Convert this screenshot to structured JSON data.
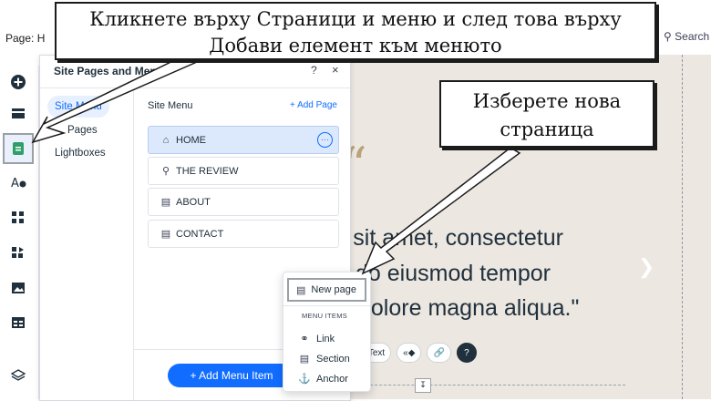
{
  "topbar": {
    "page_label": "Page:",
    "page_name_partial": "H",
    "search_label": "Search"
  },
  "rail": {
    "items": [
      {
        "name": "add-elements"
      },
      {
        "name": "sections"
      },
      {
        "name": "pages-and-menu",
        "active": true
      },
      {
        "name": "site-design"
      },
      {
        "name": "app-market"
      },
      {
        "name": "business-apps"
      },
      {
        "name": "media"
      },
      {
        "name": "cms"
      },
      {
        "name": "layers"
      }
    ]
  },
  "panel": {
    "title": "Site Pages and Menu",
    "help": "?",
    "close": "×",
    "categories": [
      "Site Menu",
      "Pages",
      "Lightboxes"
    ],
    "menu_heading": "Site Menu",
    "add_page": "+ Add Page",
    "menu_items": [
      {
        "label": "HOME",
        "icon": "home-icon"
      },
      {
        "label": "THE REVIEW",
        "icon": "pin-icon"
      },
      {
        "label": "ABOUT",
        "icon": "page-icon"
      },
      {
        "label": "CONTACT",
        "icon": "page-icon"
      }
    ],
    "add_menu_item": "+ Add Menu Item"
  },
  "canvas": {
    "quote_mark": "“",
    "lines": [
      "r sit amet, consectetur",
      "do eiusmod tempor",
      "dolore magna aliqua.\""
    ],
    "text_chip": "l Text"
  },
  "dropdown": {
    "new_page": "New page",
    "section_label": "MENU ITEMS",
    "items": [
      {
        "label": "Link",
        "icon": "link-icon"
      },
      {
        "label": "Section",
        "icon": "section-icon"
      },
      {
        "label": "Anchor",
        "icon": "anchor-icon"
      }
    ]
  },
  "callouts": {
    "top": [
      "Кликнете върху Страници и меню и след това върху",
      "Добави елемент към менюто"
    ],
    "right": [
      "Изберете нова",
      "страница"
    ]
  },
  "colors": {
    "accent": "#116dff",
    "canvas_bg": "#ece7e1",
    "quote": "#b8a37a"
  }
}
